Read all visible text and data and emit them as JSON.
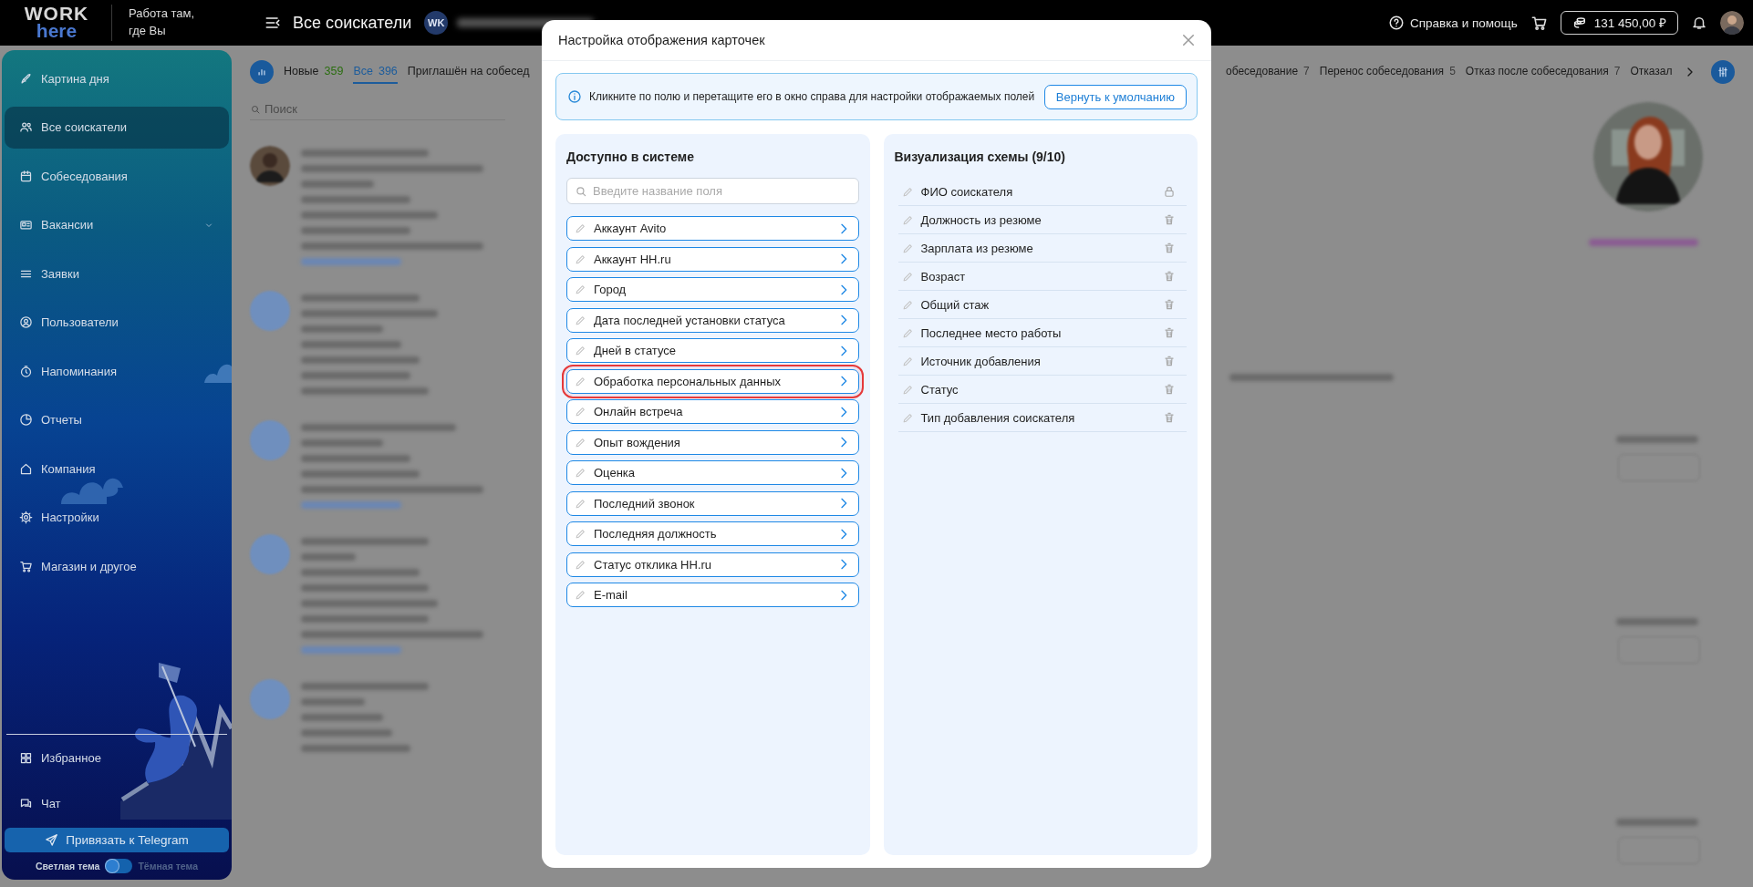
{
  "topbar": {
    "logo_top": "WORK",
    "logo_bottom": "here",
    "slogan": "Работа там, где Вы",
    "page_title": "Все соискатели",
    "company_initials": "WK",
    "help": "Справка и помощь",
    "balance": "131 450,00 ₽"
  },
  "sidebar": {
    "items": [
      {
        "label": "Картина дня",
        "kind": "link",
        "selected": false
      },
      {
        "label": "Все соискатели",
        "kind": "link",
        "selected": true
      },
      {
        "label": "Собеседования",
        "kind": "link",
        "selected": false
      },
      {
        "label": "Вакансии",
        "kind": "group",
        "selected": false
      },
      {
        "label": "Заявки",
        "kind": "link",
        "selected": false
      },
      {
        "label": "Пользователи",
        "kind": "link",
        "selected": false
      },
      {
        "label": "Напоминания",
        "kind": "link",
        "selected": false
      },
      {
        "label": "Отчеты",
        "kind": "link",
        "selected": false
      },
      {
        "label": "Компания",
        "kind": "link",
        "selected": false
      },
      {
        "label": "Настройки",
        "kind": "link",
        "selected": false
      },
      {
        "label": "Магазин и другое",
        "kind": "link",
        "selected": false
      }
    ],
    "bottom_items": [
      {
        "label": "Избранное",
        "selected": false
      },
      {
        "label": "Чат",
        "selected": false
      }
    ],
    "telegram_button": "Привязать к Telegram",
    "theme": {
      "light_label": "Светлая тема",
      "dark_label": "Тёмная тема",
      "dark": false
    }
  },
  "tabs": {
    "left": [
      {
        "label": "Новые",
        "count": "359",
        "color": "#2b6e10",
        "selected": false
      },
      {
        "label": "Все",
        "count": "396",
        "color": "#1c5c9c",
        "selected": true
      },
      {
        "label": "Приглашён на собесед",
        "selected": false
      }
    ],
    "right": [
      {
        "label": "обеседование",
        "count": "7",
        "selected": false
      },
      {
        "label": "Перенос собеседования",
        "count": "5",
        "selected": false
      },
      {
        "label": "Отказ после собеседования",
        "count": "7",
        "selected": false
      },
      {
        "label": "Отказал",
        "selected": false
      }
    ]
  },
  "search": {
    "placeholder": "Поиск"
  },
  "modal": {
    "title": "Настройка отображения карточек",
    "info": "Кликните по полю и перетащите его в окно справа для настройки отображаемых полей",
    "reset_button": "Вернуть к умолчанию",
    "available": {
      "title": "Доступно в системе",
      "search_placeholder": "Введите название поля",
      "fields": [
        {
          "label": "Аккаунт Avito",
          "highlighted": false
        },
        {
          "label": "Аккаунт HH.ru",
          "highlighted": false
        },
        {
          "label": "Город",
          "highlighted": false
        },
        {
          "label": "Дата последней установки статуса",
          "highlighted": false
        },
        {
          "label": "Дней в статусе",
          "highlighted": false
        },
        {
          "label": "Обработка персональных данных",
          "highlighted": true
        },
        {
          "label": "Онлайн встреча",
          "highlighted": false
        },
        {
          "label": "Опыт вождения",
          "highlighted": false
        },
        {
          "label": "Оценка",
          "highlighted": false
        },
        {
          "label": "Последний звонок",
          "highlighted": false
        },
        {
          "label": "Последняя должность",
          "highlighted": false
        },
        {
          "label": "Статус отклика HH.ru",
          "highlighted": false
        },
        {
          "label": "E-mail",
          "highlighted": false
        }
      ]
    },
    "scheme": {
      "title": "Визуализация схемы (9/10)",
      "fields": [
        {
          "label": "ФИО соискателя",
          "locked": true
        },
        {
          "label": "Должность из резюме",
          "locked": false
        },
        {
          "label": "Зарплата из резюме",
          "locked": false
        },
        {
          "label": "Возраст",
          "locked": false
        },
        {
          "label": "Общий стаж",
          "locked": false
        },
        {
          "label": "Последнее место работы",
          "locked": false
        },
        {
          "label": "Источник добавления",
          "locked": false
        },
        {
          "label": "Статус",
          "locked": false
        },
        {
          "label": "Тип добавления соискателя",
          "locked": false
        }
      ]
    }
  }
}
